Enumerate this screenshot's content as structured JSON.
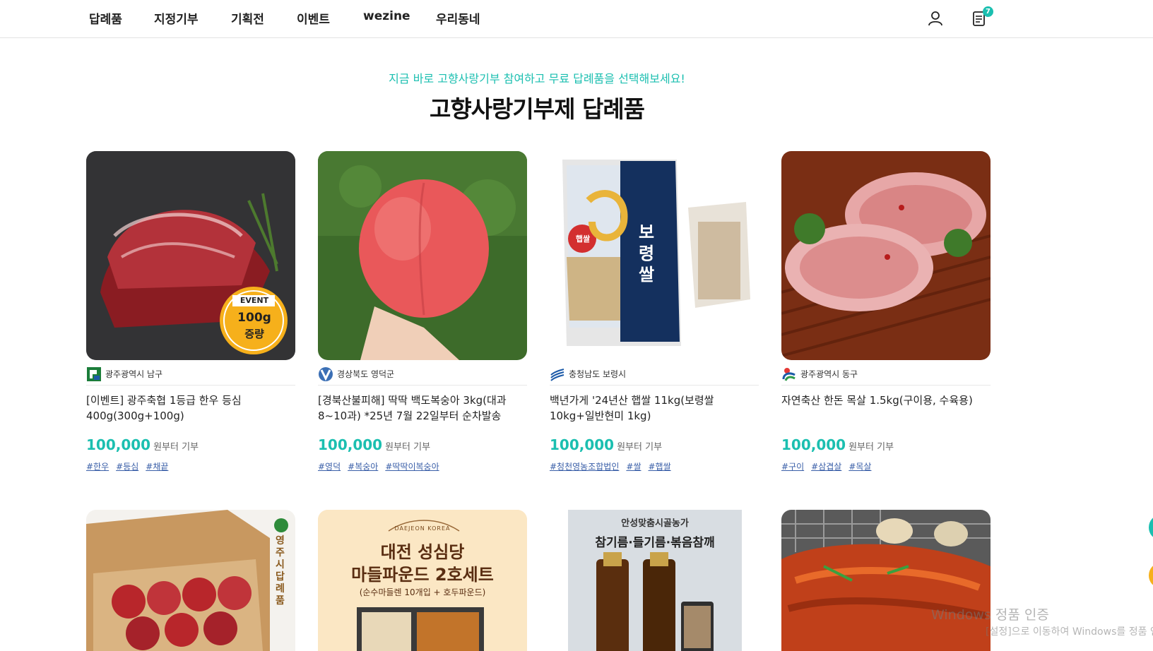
{
  "nav": {
    "items": [
      "답례품",
      "지정기부",
      "기획전",
      "이벤트",
      "wezine",
      "우리동네"
    ],
    "cart_badge": "7"
  },
  "hero": {
    "subtitle": "지금 바로 고향사랑기부 참여하고 무료 답례품을 선택해보세요!",
    "title": "고향사랑기부제 답례품"
  },
  "products": [
    {
      "region": "광주광역시 남구",
      "name": "[이벤트] 광주축협 1등급 한우 등심 400g(300g+100g)",
      "price": "100,000",
      "price_suffix": "원부터 기부",
      "tags": [
        "#한우",
        "#등심",
        "#채끝"
      ],
      "badge_top": "EVENT",
      "badge_line1": "100g",
      "badge_line2": "증량"
    },
    {
      "region": "경상북도 영덕군",
      "name": "[경북산불피해] 딱딱 백도복숭아 3kg(대과 8~10과) *25년 7월 22일부터 순차발송",
      "price": "100,000",
      "price_suffix": "원부터 기부",
      "tags": [
        "#영덕",
        "#복숭아",
        "#딱딱이복숭아"
      ]
    },
    {
      "region": "충청남도 보령시",
      "name": "백년가게 '24년산 햅쌀 11kg(보령쌀 10kg+일반현미 1kg)",
      "price": "100,000",
      "price_suffix": "원부터 기부",
      "tags": [
        "#청천영농조합법인",
        "#쌀",
        "#햅쌀"
      ],
      "pkg_text": "보령쌀",
      "pkg_badge": "햅쌀"
    },
    {
      "region": "광주광역시 동구",
      "name": "자연축산 한돈 목살 1.5kg(구이용, 수육용)",
      "price": "100,000",
      "price_suffix": "원부터 기부",
      "tags": [
        "#구이",
        "#삼겹살",
        "#목살"
      ]
    }
  ],
  "row2": {
    "apple_label": "영주시 답례품",
    "cake_brand": "DAEJEON KOREA",
    "cake_title1": "대전 성심당",
    "cake_title2": "마들파운드 2호세트",
    "cake_sub": "(순수마들렌 10개입 + 호두파운드)",
    "oil_brand": "안성맞춤시골농가",
    "oil_title": "참기름·들기름·볶음참깨"
  },
  "watermark": {
    "line1": "Windows 정품 인증",
    "line2": "[설정]으로 이동하여 Windows를 정품 인증합니다."
  },
  "colors": {
    "accent": "#1bbfb0",
    "tag": "#3a5fa8"
  }
}
